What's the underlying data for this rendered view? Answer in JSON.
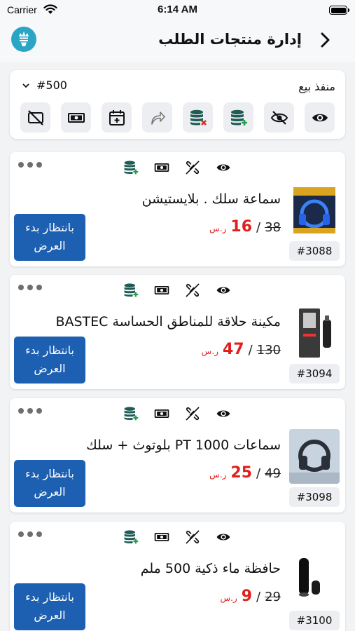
{
  "status_bar": {
    "carrier": "Carrier",
    "time": "6:14 AM"
  },
  "header": {
    "title": "إدارة منتجات الطلب"
  },
  "filter": {
    "outlet_label": "منفذ بيع",
    "outlet_value": "#500",
    "tools": [
      "camera-off-icon",
      "cash-icon",
      "calendar-add-icon",
      "share-arrow-icon",
      "database-remove-icon",
      "database-add-icon",
      "eye-off-icon",
      "eye-icon"
    ]
  },
  "colors": {
    "primary": "#1d5fb0",
    "price_red": "#e0201e",
    "teal": "#1f5c55",
    "green": "#21a04b",
    "remove_red": "#d0302a"
  },
  "products": [
    {
      "name": "سماعة سلك . بلايستيشن",
      "old_price": "38",
      "new_price": "16",
      "currency": "ر.س",
      "separator": "/",
      "id": "#3088",
      "status": "بانتظار بدء العرض"
    },
    {
      "name": "مكينة حلاقة للمناطق الحساسة BASTEC",
      "old_price": "130",
      "new_price": "47",
      "currency": "ر.س",
      "separator": "/",
      "id": "#3094",
      "status": "بانتظار بدء العرض"
    },
    {
      "name": "سماعات PT 1000  بلوتوث + سلك",
      "old_price": "49",
      "new_price": "25",
      "currency": "ر.س",
      "separator": "/",
      "id": "#3098",
      "status": "بانتظار بدء العرض"
    },
    {
      "name": "حافظة ماء ذكية 500 ملم",
      "old_price": "29",
      "new_price": "9",
      "currency": "ر.س",
      "separator": "/",
      "id": "#3100",
      "status": "بانتظار بدء العرض"
    }
  ]
}
